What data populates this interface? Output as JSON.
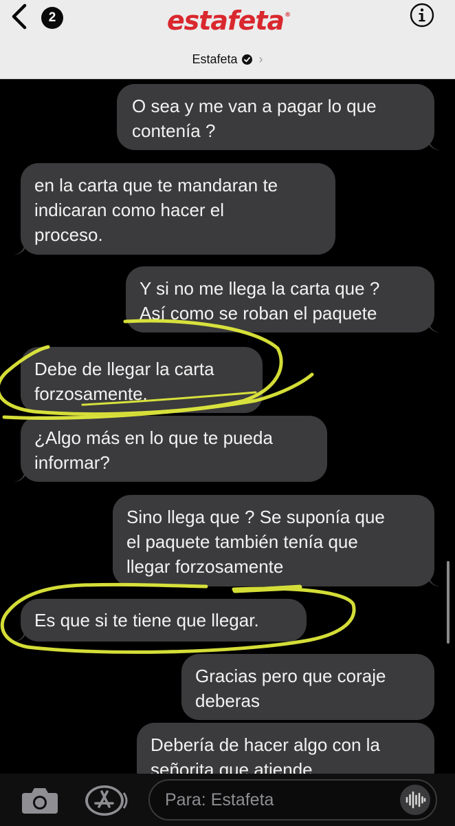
{
  "header": {
    "back_icon": "chevron-left-icon",
    "unread_count": "2",
    "brand_logo_text": "estafeta",
    "brand_color": "#d9282e",
    "info_icon": "info-icon",
    "contact_name": "Estafeta",
    "verified_icon": "verified-badge-icon",
    "chevron_icon": "chevron-right-icon",
    "chevron_glyph": "›"
  },
  "messages": [
    {
      "sender": "me",
      "text": "O sea y me van a pagar lo que\ncontenía ?"
    },
    {
      "sender": "business",
      "text": "en la carta que te mandaran te\nindicaran como hacer el\nproceso."
    },
    {
      "sender": "me",
      "text": "Y si no me llega la carta que ?\nAsí como se roban el paquete"
    },
    {
      "sender": "business",
      "text": "Debe de llegar la carta\nforzosamente.",
      "highlighted": true
    },
    {
      "sender": "business",
      "text": "¿Algo más en lo que te pueda\ninformar?"
    },
    {
      "sender": "me",
      "text": "Sino llega que ? Se suponía que\nel paquete también tenía que\nllegar forzosamente"
    },
    {
      "sender": "business",
      "text": "Es que si te tiene que llegar.",
      "highlighted": true
    },
    {
      "sender": "me",
      "text": "Gracias pero que coraje\ndeberas"
    },
    {
      "sender": "me",
      "text": "Debería de hacer algo con la\nseñorita que atiende"
    }
  ],
  "colors": {
    "bubble": "#3b3b3d",
    "highlighter": "#e6f03c",
    "background": "#000000"
  },
  "composer": {
    "placeholder": "Para: Estafeta",
    "camera_icon": "camera-icon",
    "appstore_icon": "app-store-icon",
    "voice_icon": "voice-waveform-icon"
  }
}
